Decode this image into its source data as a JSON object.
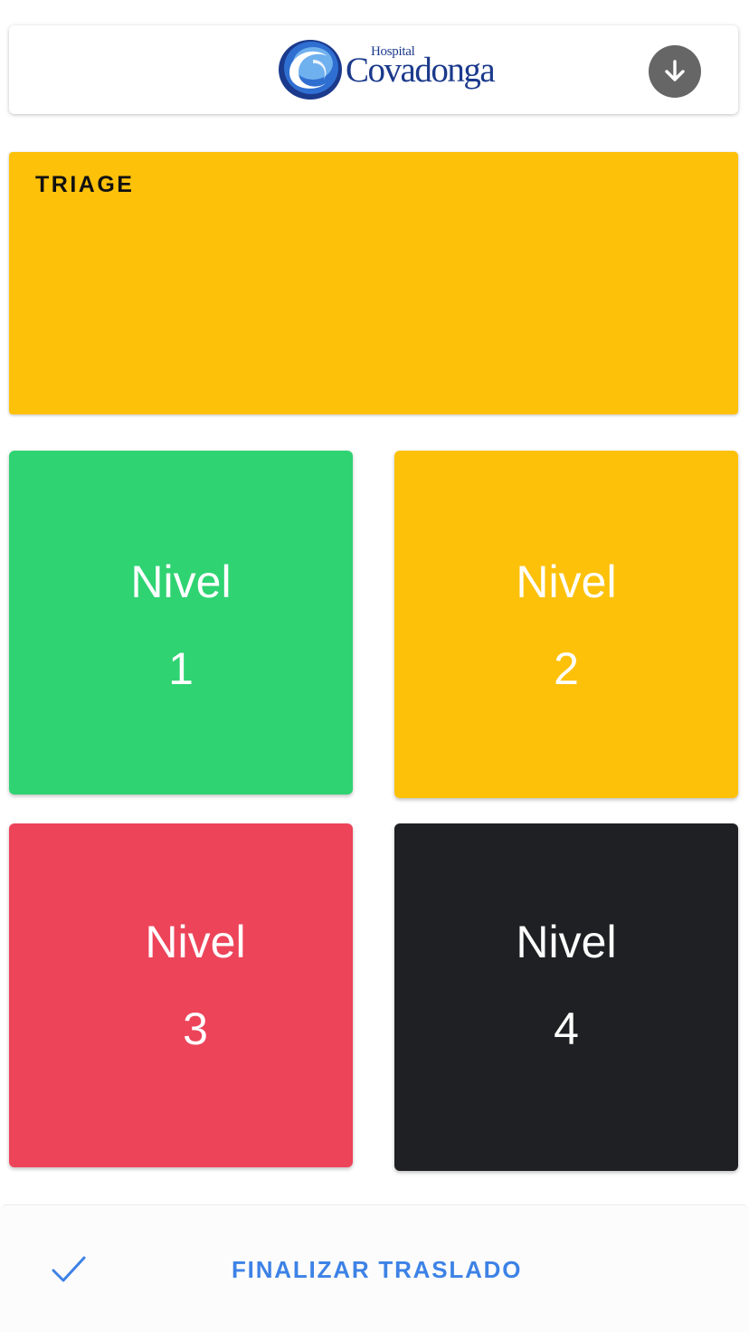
{
  "header": {
    "logo": {
      "small_text": "Hospital",
      "big_text": "Covadonga",
      "brand_color": "#1b3a8c"
    },
    "download_icon": "arrow-down-icon",
    "download_button_color": "#666666"
  },
  "triage": {
    "title": "TRIAGE",
    "color": "#fdc10a"
  },
  "levels": [
    {
      "label": "Nivel",
      "number": "1",
      "color": "#2fd372"
    },
    {
      "label": "Nivel",
      "number": "2",
      "color": "#fdc10a"
    },
    {
      "label": "Nivel",
      "number": "3",
      "color": "#ed445a"
    },
    {
      "label": "Nivel",
      "number": "4",
      "color": "#1f2023"
    }
  ],
  "footer": {
    "icon": "check-icon",
    "action_label": "FINALIZAR TRASLADO",
    "action_color": "#3d82e6"
  }
}
